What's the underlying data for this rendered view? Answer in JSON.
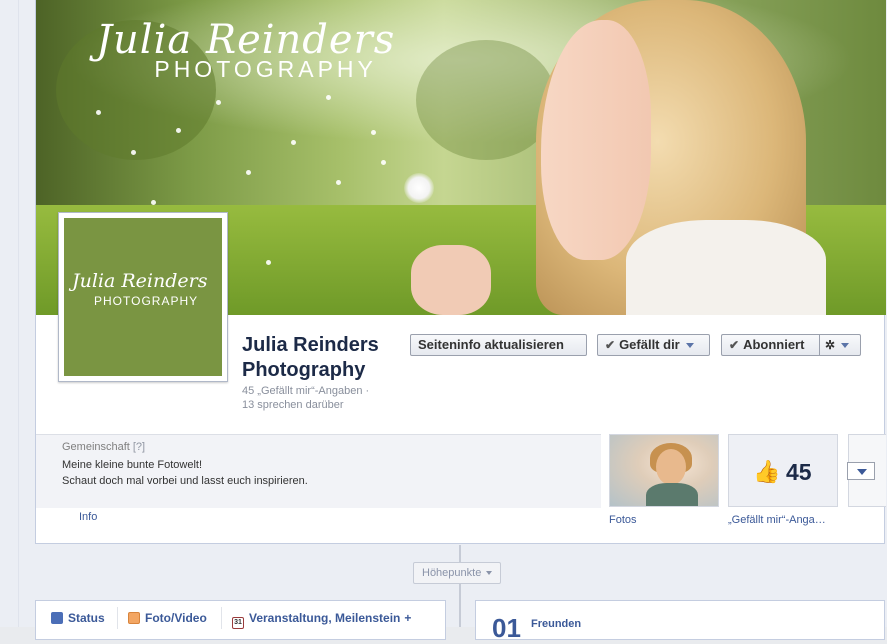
{
  "cover": {
    "logo_script": "Julia Reinders",
    "logo_caps": "PHOTOGRAPHY"
  },
  "profile_picture": {
    "logo_script": "Julia Reinders",
    "logo_caps": "PHOTOGRAPHY",
    "color": "#7a9542"
  },
  "page": {
    "name": "Julia Reinders Photography",
    "stats_likes": "45 „Gefällt mir“-Angaben ·",
    "stats_talking": "13 sprechen darüber"
  },
  "buttons": {
    "update_info": "Seiteninfo aktualisieren",
    "liked": "Gefällt dir",
    "subscribed": "Abonniert"
  },
  "about": {
    "category": "Gemeinschaft",
    "category_help": "[?]",
    "description_line1": "Meine kleine bunte Fotowelt!",
    "description_line2": "Schaut doch mal vorbei und lasst euch inspirieren.",
    "info_link": "Info"
  },
  "apps": [
    {
      "label": "Fotos"
    },
    {
      "label": "„Gefällt mir“-Anga…",
      "count": "45"
    }
  ],
  "timeline": {
    "highlights": "Höhepunkte"
  },
  "composer": {
    "status": "Status",
    "photo_video": "Foto/Video",
    "event": "Veranstaltung, Meilenstein",
    "event_plus": "+",
    "calendar_day": "31"
  },
  "friends": {
    "count_partial": "01",
    "label": "Freunden"
  },
  "colors": {
    "link": "#3b5998",
    "brand_green": "#7a9542",
    "page_bg": "#ebeef4"
  }
}
